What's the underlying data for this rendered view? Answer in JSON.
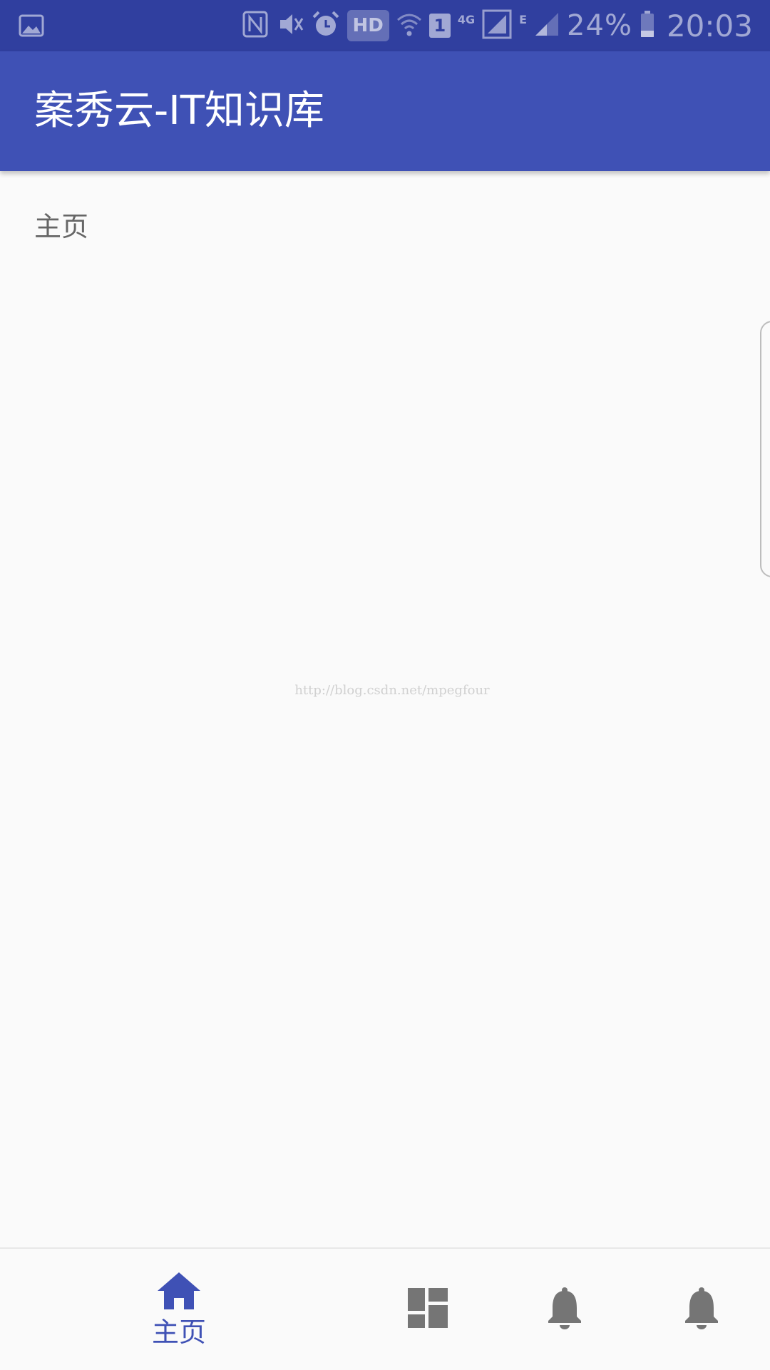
{
  "status_bar": {
    "hd_badge": "HD",
    "sim_slot": "1",
    "network_4g": "4G",
    "network_e": "E",
    "battery": "24%",
    "time": "20:03",
    "icons": [
      "image-icon",
      "nfc-icon",
      "vibrate-icon",
      "alarm-icon",
      "wifi-icon",
      "signal-icon",
      "battery-icon"
    ]
  },
  "app_bar": {
    "title": "案秀云-IT知识库"
  },
  "content": {
    "label": "主页",
    "watermark": "http://blog.csdn.net/mpegfour"
  },
  "bottom_nav": {
    "items": [
      {
        "icon": "home-icon",
        "label": "主页",
        "active": true
      },
      {
        "icon": "dashboard-icon",
        "label": "",
        "active": false
      },
      {
        "icon": "bell-icon",
        "label": "",
        "active": false
      },
      {
        "icon": "bell-icon",
        "label": "",
        "active": false
      }
    ]
  },
  "colors": {
    "status_bar": "#303f9f",
    "primary": "#3f51b5",
    "background": "#fafafa",
    "inactive_icon": "#757575",
    "label_text": "#666666"
  }
}
